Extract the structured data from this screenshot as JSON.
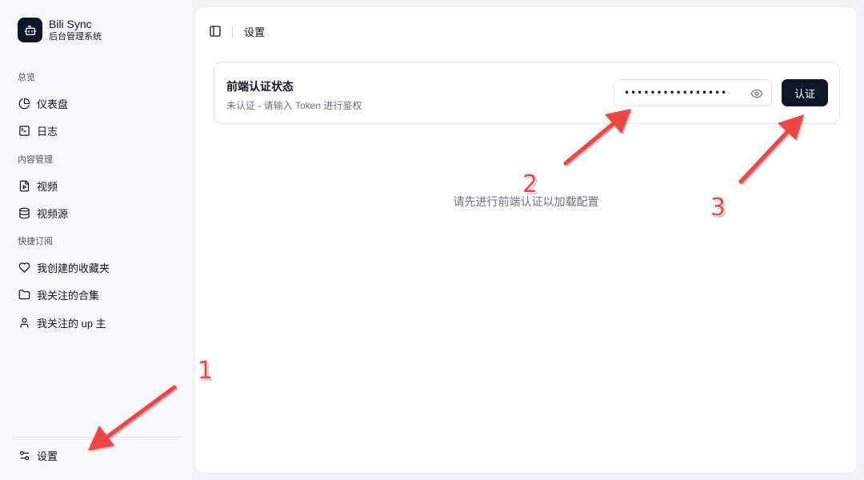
{
  "brand": {
    "title": "Bili Sync",
    "subtitle": "后台管理系统",
    "logo_icon": "bot-icon"
  },
  "sidebar": {
    "groups": [
      {
        "label": "总览",
        "items": [
          {
            "label": "仪表盘",
            "icon": "pie-chart-icon"
          },
          {
            "label": "日志",
            "icon": "terminal-icon"
          }
        ]
      },
      {
        "label": "内容管理",
        "items": [
          {
            "label": "视频",
            "icon": "file-video-icon"
          },
          {
            "label": "视频源",
            "icon": "database-icon"
          }
        ]
      },
      {
        "label": "快捷订阅",
        "items": [
          {
            "label": "我创建的收藏夹",
            "icon": "heart-icon"
          },
          {
            "label": "我关注的合集",
            "icon": "folder-icon"
          },
          {
            "label": "我关注的 up 主",
            "icon": "user-icon"
          }
        ]
      }
    ],
    "footer": {
      "label": "设置",
      "icon": "settings-sliders-icon"
    }
  },
  "topbar": {
    "breadcrumb": "设置"
  },
  "auth_card": {
    "title": "前端认证状态",
    "description": "未认证 - 请输入 Token 进行鉴权",
    "token_value": "••••••••••••••••",
    "submit_label": "认证"
  },
  "hint": "请先进行前端认证以加载配置",
  "annotations": [
    {
      "number": "1"
    },
    {
      "number": "2"
    },
    {
      "number": "3"
    }
  ],
  "colors": {
    "accent": "#0f172a",
    "annotation": "#ef4444",
    "muted": "#6b7280"
  }
}
